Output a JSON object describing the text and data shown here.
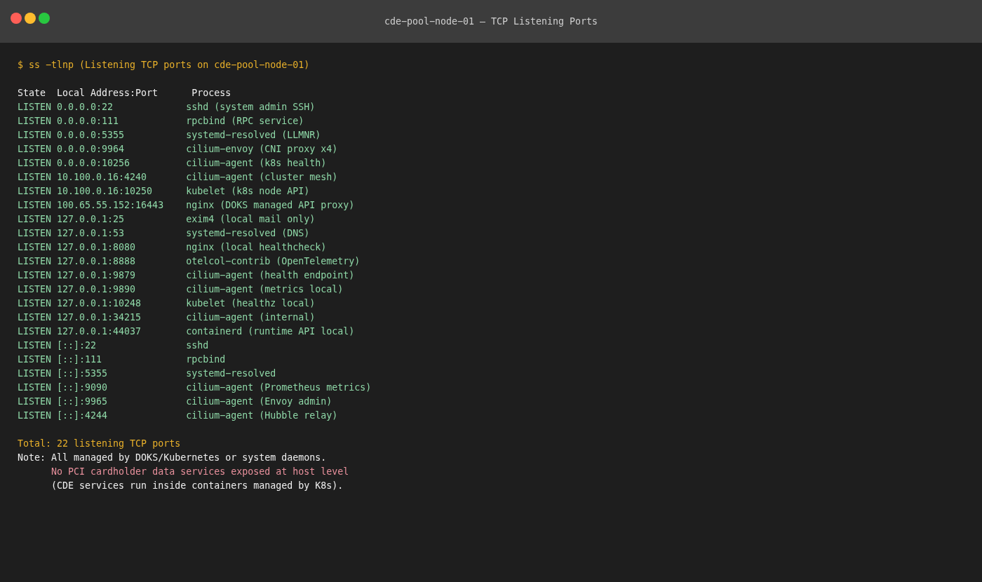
{
  "window": {
    "title": "cde−pool−node−01 — TCP Listening Ports"
  },
  "command": "$ ss −tlnp (Listening TCP ports on cde−pool−node−01)",
  "table": {
    "columns": [
      "State",
      "Local Address:Port",
      "Process"
    ],
    "rows": [
      {
        "state": "LISTEN",
        "address": "0.0.0.0:22",
        "process": "sshd (system admin SSH)"
      },
      {
        "state": "LISTEN",
        "address": "0.0.0.0:111",
        "process": "rpcbind (RPC service)"
      },
      {
        "state": "LISTEN",
        "address": "0.0.0.0:5355",
        "process": "systemd−resolved (LLMNR)"
      },
      {
        "state": "LISTEN",
        "address": "0.0.0.0:9964",
        "process": "cilium−envoy (CNI proxy x4)"
      },
      {
        "state": "LISTEN",
        "address": "0.0.0.0:10256",
        "process": "cilium−agent (k8s health)"
      },
      {
        "state": "LISTEN",
        "address": "10.100.0.16:4240",
        "process": "cilium−agent (cluster mesh)"
      },
      {
        "state": "LISTEN",
        "address": "10.100.0.16:10250",
        "process": "kubelet (k8s node API)"
      },
      {
        "state": "LISTEN",
        "address": "100.65.55.152:16443",
        "process": "nginx (DOKS managed API proxy)"
      },
      {
        "state": "LISTEN",
        "address": "127.0.0.1:25",
        "process": "exim4 (local mail only)"
      },
      {
        "state": "LISTEN",
        "address": "127.0.0.1:53",
        "process": "systemd−resolved (DNS)"
      },
      {
        "state": "LISTEN",
        "address": "127.0.0.1:8080",
        "process": "nginx (local healthcheck)"
      },
      {
        "state": "LISTEN",
        "address": "127.0.0.1:8888",
        "process": "otelcol−contrib (OpenTelemetry)"
      },
      {
        "state": "LISTEN",
        "address": "127.0.0.1:9879",
        "process": "cilium−agent (health endpoint)"
      },
      {
        "state": "LISTEN",
        "address": "127.0.0.1:9890",
        "process": "cilium−agent (metrics local)"
      },
      {
        "state": "LISTEN",
        "address": "127.0.0.1:10248",
        "process": "kubelet (healthz local)"
      },
      {
        "state": "LISTEN",
        "address": "127.0.0.1:34215",
        "process": "cilium−agent (internal)"
      },
      {
        "state": "LISTEN",
        "address": "127.0.0.1:44037",
        "process": "containerd (runtime API local)"
      },
      {
        "state": "LISTEN",
        "address": "[::]:22",
        "process": "sshd"
      },
      {
        "state": "LISTEN",
        "address": "[::]:111",
        "process": "rpcbind"
      },
      {
        "state": "LISTEN",
        "address": "[::]:5355",
        "process": "systemd−resolved"
      },
      {
        "state": "LISTEN",
        "address": "[::]:9090",
        "process": "cilium−agent (Prometheus metrics)"
      },
      {
        "state": "LISTEN",
        "address": "[::]:9965",
        "process": "cilium−agent (Envoy admin)"
      },
      {
        "state": "LISTEN",
        "address": "[::]:4244",
        "process": "cilium−agent (Hubble relay)"
      }
    ]
  },
  "total": "Total: 22 listening TCP ports",
  "note": {
    "label": "Note:",
    "lines": [
      {
        "text": "All managed by DOKS/Kubernetes or system daemons.",
        "kind": "plain"
      },
      {
        "text": "No PCI cardholder data services exposed at host level",
        "kind": "warning"
      },
      {
        "text": "(CDE services run inside containers managed by K8s).",
        "kind": "plain"
      }
    ]
  }
}
